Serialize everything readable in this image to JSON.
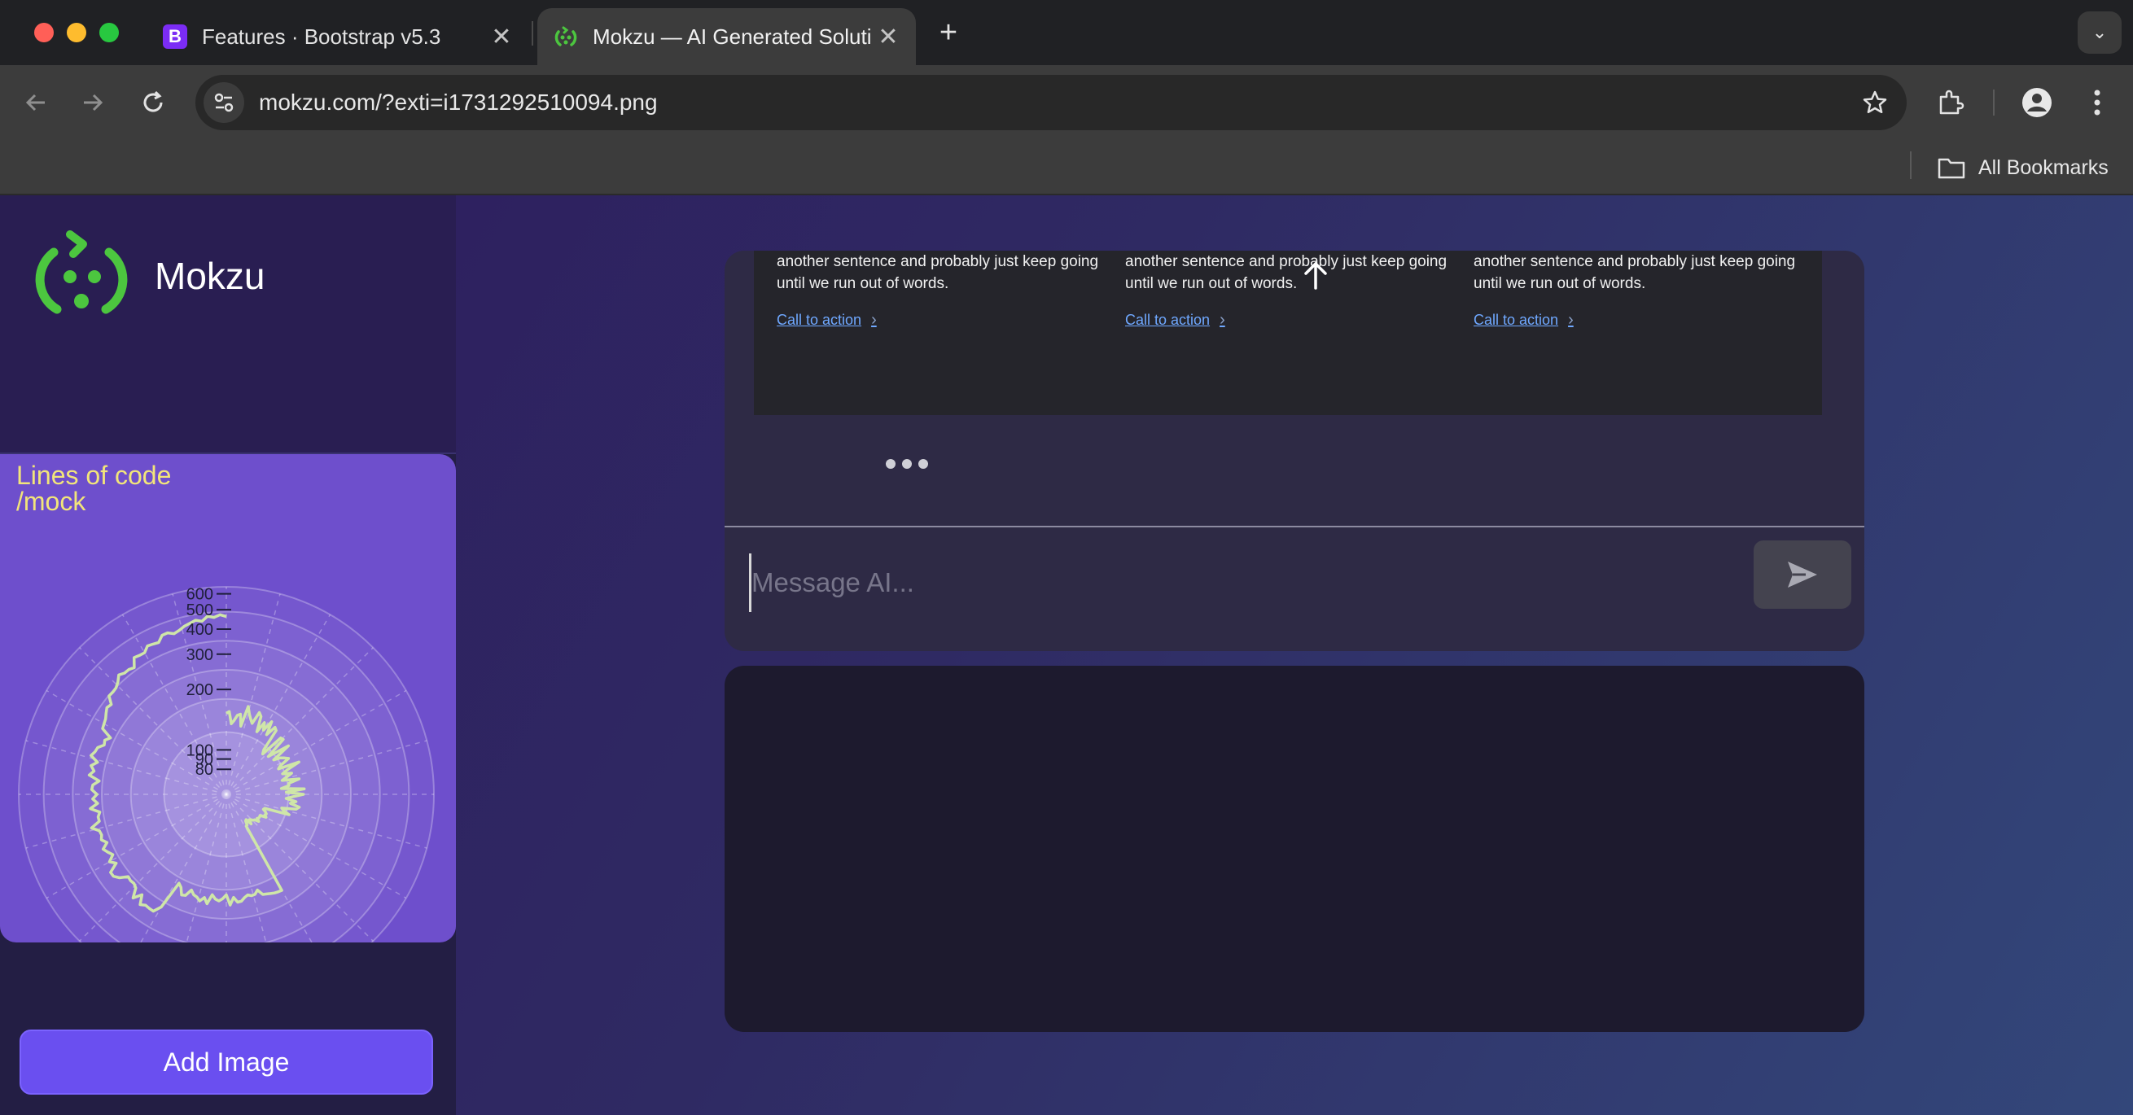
{
  "browser": {
    "tabs": [
      {
        "title": "Features · Bootstrap v5.3",
        "favicon": "bootstrap-icon",
        "favicon_letter": "B",
        "active": false
      },
      {
        "title": "Mokzu — AI Generated Soluti",
        "favicon": "mokzu-icon",
        "active": true
      }
    ],
    "tab_close_glyph": "✕",
    "new_tab_glyph": "+",
    "tab_search_glyph": "⌄",
    "url": "mokzu.com/?exti=i1731292510094.png",
    "bookmarks_label": "All Bookmarks",
    "colors": {
      "chrome_dark": "#202124",
      "chrome": "#3c3c3c",
      "omnibox": "#282828"
    }
  },
  "sidebar": {
    "brand": "Mokzu",
    "add_image_label": "Add Image",
    "colors": {
      "accent": "#6a4ff0",
      "card": "#6e4fcc",
      "logo_green": "#4cc63f"
    }
  },
  "chart_data": {
    "type": "polar-line",
    "title_lines": [
      "Lines of code",
      "/mock"
    ],
    "radial_scale": "log",
    "radial_ticks": [
      80,
      90,
      100,
      200,
      300,
      400,
      500,
      600
    ],
    "series_color": "#cfe6a8",
    "grid": true
  },
  "chat": {
    "features": [
      {
        "text": "another sentence and probably just keep going until we run out of words.",
        "cta": "Call to action"
      },
      {
        "text": "another sentence and probably just keep going until we run out of words.",
        "cta": "Call to action"
      },
      {
        "text": "another sentence and probably just keep going until we run out of words.",
        "cta": "Call to action"
      }
    ],
    "cta_chevron": "›",
    "input_placeholder": "Message AI...",
    "input_value": "",
    "send_icon": "send-icon"
  }
}
